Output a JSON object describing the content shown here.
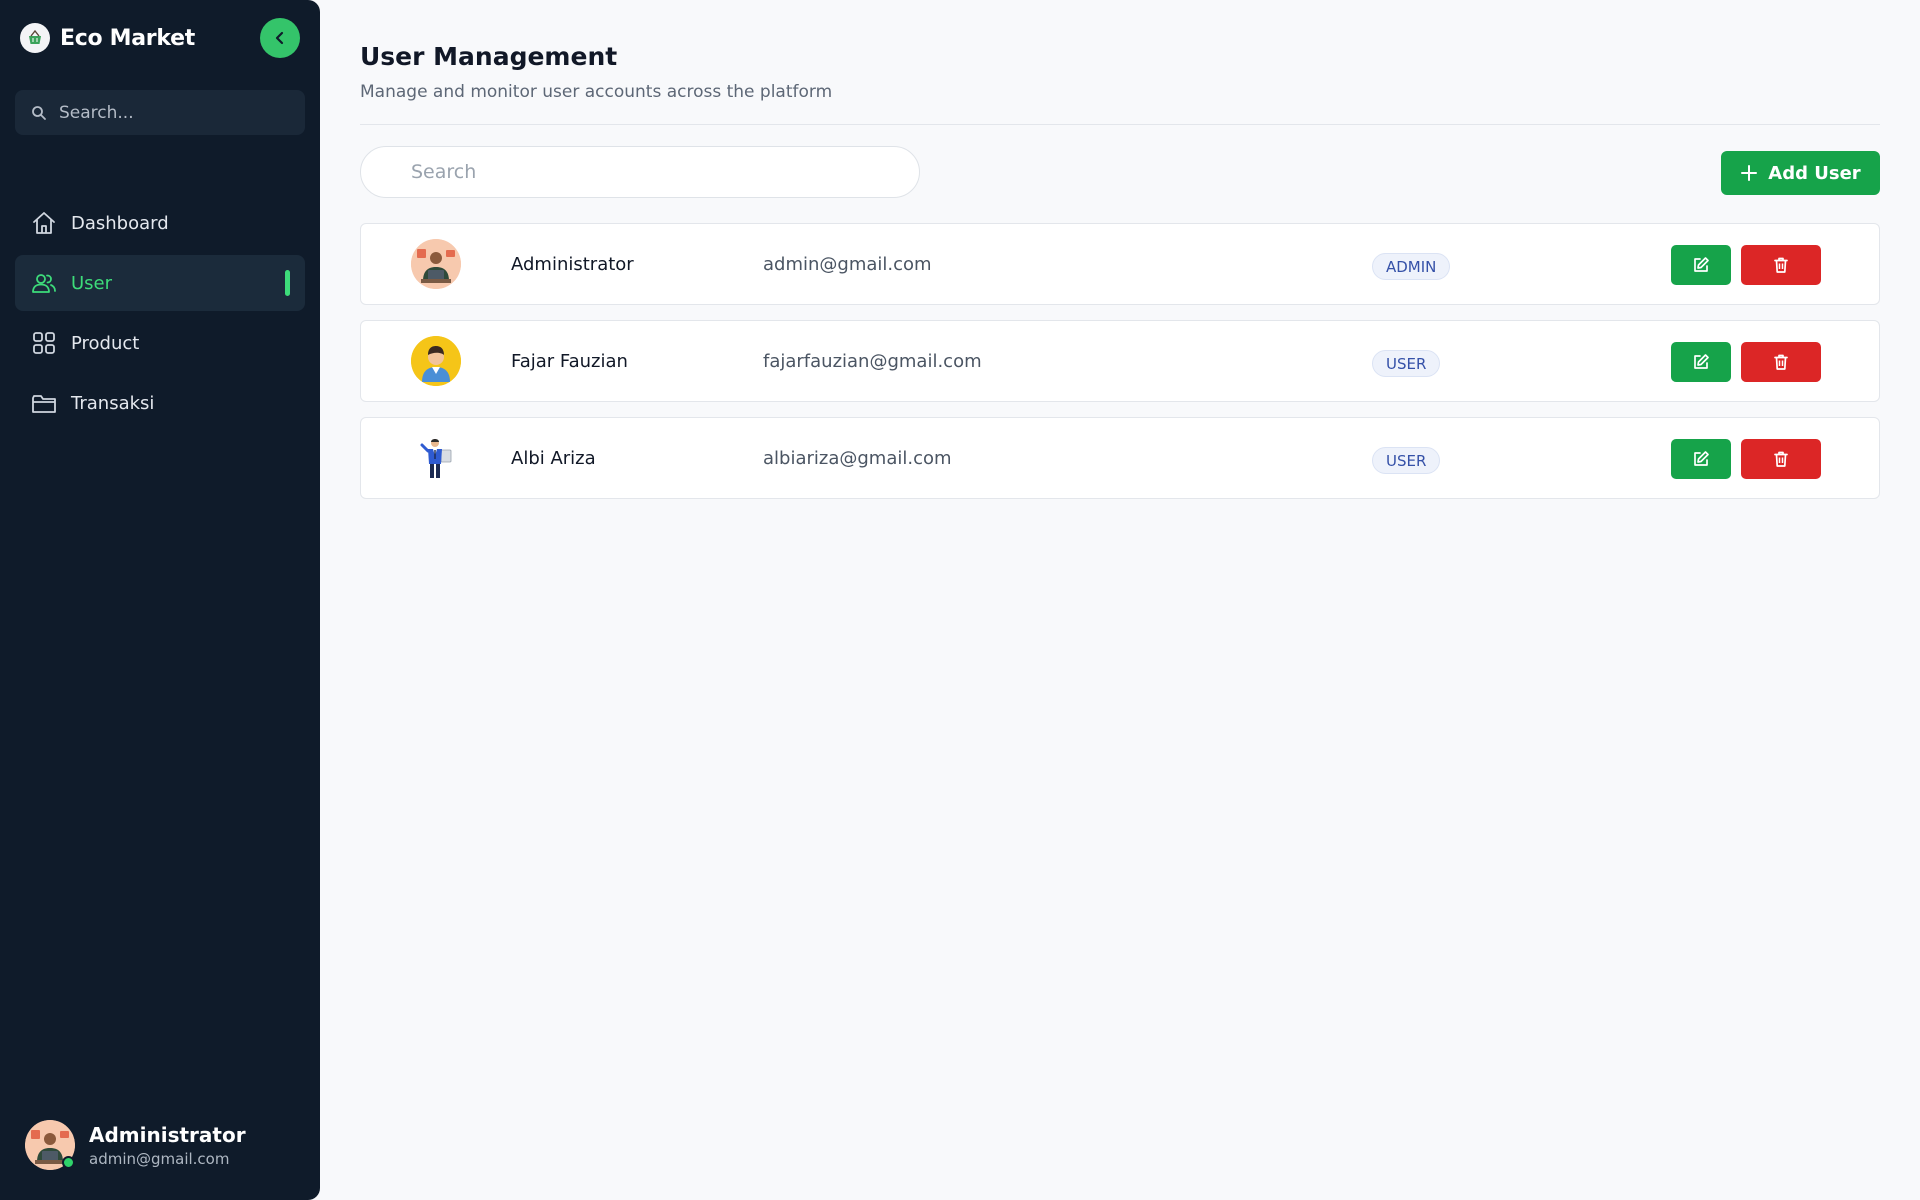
{
  "sidebar": {
    "brand": {
      "name": "Eco Market",
      "logo_icon": "basket-icon"
    },
    "collapse_icon": "chevron-left-icon",
    "search": {
      "placeholder": "Search...",
      "value": ""
    },
    "nav": [
      {
        "label": "Dashboard",
        "icon": "home-icon",
        "active": false
      },
      {
        "label": "User",
        "icon": "users-icon",
        "active": true
      },
      {
        "label": "Product",
        "icon": "grid-icon",
        "active": false
      },
      {
        "label": "Transaksi",
        "icon": "folder-icon",
        "active": false
      }
    ],
    "profile": {
      "name": "Administrator",
      "email": "admin@gmail.com",
      "status": "online"
    }
  },
  "main": {
    "title": "User Management",
    "subtitle": "Manage and monitor user accounts across the platform",
    "search": {
      "placeholder": "Search",
      "value": ""
    },
    "add_button": "Add User",
    "users": [
      {
        "name": "Administrator",
        "email": "admin@gmail.com",
        "role": "ADMIN"
      },
      {
        "name": "Fajar Fauzian",
        "email": "fajarfauzian@gmail.com",
        "role": "USER"
      },
      {
        "name": "Albi Ariza",
        "email": "albiariza@gmail.com",
        "role": "USER"
      }
    ]
  },
  "colors": {
    "sidebar_bg": "#0f1b2a",
    "accent_green": "#16a34a",
    "active_green": "#3ddc7a",
    "danger_red": "#dc2626",
    "badge_text": "#3551a8"
  }
}
